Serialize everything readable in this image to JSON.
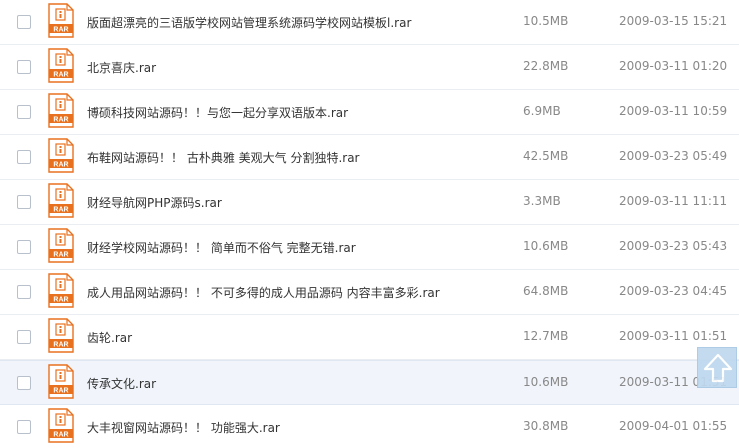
{
  "files": [
    {
      "name": "版面超漂亮的三语版学校网站管理系统源码学校网站模板l.rar",
      "size": "10.5MB",
      "date": "2009-03-15 15:21",
      "icon": "rar-file-icon",
      "icon_label": "RAR"
    },
    {
      "name": "北京喜庆.rar",
      "size": "22.8MB",
      "date": "2009-03-11 01:20",
      "icon": "rar-file-icon",
      "icon_label": "RAR"
    },
    {
      "name": "博硕科技网站源码！！与您一起分享双语版本.rar",
      "size": "6.9MB",
      "date": "2009-03-11 10:59",
      "icon": "rar-file-icon",
      "icon_label": "RAR"
    },
    {
      "name": "布鞋网站源码！！ 古朴典雅 美观大气 分割独特.rar",
      "size": "42.5MB",
      "date": "2009-03-23 05:49",
      "icon": "rar-file-icon",
      "icon_label": "RAR"
    },
    {
      "name": "财经导航网PHP源码s.rar",
      "size": "3.3MB",
      "date": "2009-03-11 11:11",
      "icon": "rar-file-icon",
      "icon_label": "RAR"
    },
    {
      "name": "财经学校网站源码！！ 简单而不俗气 完整无错.rar",
      "size": "10.6MB",
      "date": "2009-03-23 05:43",
      "icon": "rar-file-icon",
      "icon_label": "RAR"
    },
    {
      "name": "成人用品网站源码！！ 不可多得的成人用品源码 内容丰富多彩.rar",
      "size": "64.8MB",
      "date": "2009-03-23 04:45",
      "icon": "rar-file-icon",
      "icon_label": "RAR"
    },
    {
      "name": "齿轮.rar",
      "size": "12.7MB",
      "date": "2009-03-11 01:51",
      "icon": "rar-file-icon",
      "icon_label": "RAR"
    },
    {
      "name": "传承文化.rar",
      "size": "10.6MB",
      "date": "2009-03-11 01:51",
      "icon": "rar-file-icon",
      "icon_label": "RAR"
    },
    {
      "name": "大丰视窗网站源码！！ 功能强大.rar",
      "size": "30.8MB",
      "date": "2009-04-01 01:55",
      "icon": "rar-file-icon",
      "icon_label": "RAR"
    }
  ],
  "hover_row_index": 8,
  "back_to_top": {
    "icon": "arrow-up-icon"
  },
  "colors": {
    "icon_orange": "#e8711f",
    "hover_bg": "#f1f5fb",
    "meta_text": "#888888"
  }
}
